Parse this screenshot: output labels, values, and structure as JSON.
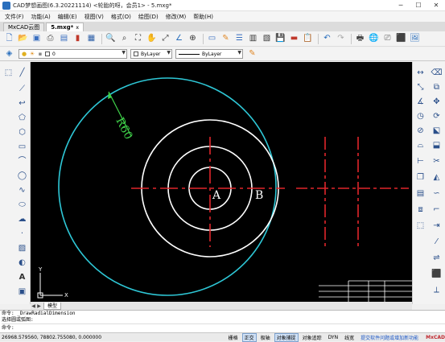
{
  "window": {
    "title": "CAD梦想画图(6.3.20221114) <轮胎的呀，会员1> - 5.mxg*",
    "minimize": "─",
    "maximize": "☐",
    "close": "✕"
  },
  "menu": [
    "文件(F)",
    "功能(A)",
    "编辑(E)",
    "视图(V)",
    "格式(O)",
    "绘图(D)",
    "修改(M)",
    "帮助(H)"
  ],
  "tabs": [
    {
      "label": "MxCAD云图",
      "close": ""
    },
    {
      "label": "5.mxg*",
      "close": "x"
    }
  ],
  "toolbar1_icons": [
    "new-file-icon",
    "open-folder-icon",
    "save-icon",
    "print-icon",
    "save-as-icon",
    "bookmark-icon",
    "save-disk-icon",
    "zoom-window-icon",
    "zoom-realtime-icon",
    "zoom-extents-icon",
    "pan-hand-icon",
    "zoom-previous-icon",
    "measure-icon",
    "zoom-magnify-icon",
    "layer-properties-icon",
    "match-pencil-icon",
    "properties-list-icon",
    "block-icon",
    "table-icon",
    "disk-save-icon",
    "note-icon",
    "clipboard-icon",
    "undo-icon",
    "redo-icon",
    "printer-icon",
    "web-icon",
    "stamp-icon",
    "pdf-icon",
    "image-icon"
  ],
  "layer": {
    "current": "0",
    "color": "ByLayer",
    "linetype": "ByLayer"
  },
  "canvas": {
    "background": "#000000",
    "circle_colors": {
      "big": "#2ec7d6",
      "concentric": "#ffffff",
      "centerline": "#e0262a",
      "dimension": "#3fd14a"
    },
    "labels": {
      "point_a": "A",
      "point_b": "B",
      "radius": "R60"
    },
    "ucs": {
      "x": "X",
      "y": "Y"
    }
  },
  "sheet": {
    "model_tab": "模型",
    "nav_prev": "◀",
    "nav_next": "▶"
  },
  "command": {
    "lines": [
      "命令: _DrawRadialDimension",
      "选择圆或弧图:",
      "命令:"
    ],
    "prompt": "命令:"
  },
  "status": {
    "coords": "26968.579560,  78802.755080,  0.000000",
    "buttons": [
      {
        "label": "栅格",
        "on": false
      },
      {
        "label": "正交",
        "on": true
      },
      {
        "label": "极轴",
        "on": false
      },
      {
        "label": "对象捕捉",
        "on": true
      },
      {
        "label": "对象追踪",
        "on": false
      },
      {
        "label": "DYN",
        "on": false
      },
      {
        "label": "线宽",
        "on": false
      }
    ],
    "link": "提交软件问题或增加新功能",
    "brand": "MxCAD"
  }
}
